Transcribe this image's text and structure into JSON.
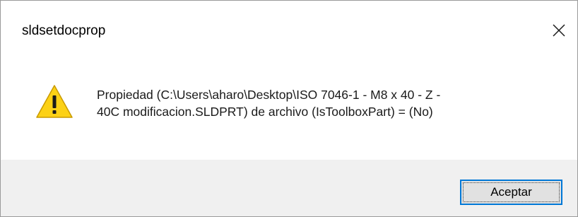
{
  "dialog": {
    "title": "sldsetdocprop",
    "close_icon": "close-icon",
    "warning_icon": "warning-icon",
    "message": "Propiedad (C:\\Users\\aharo\\Desktop\\ISO 7046-1 - M8 x 40 - Z -\n40C modificacion.SLDPRT) de archivo (IsToolboxPart) = (No)",
    "ok_label": "Aceptar"
  },
  "colors": {
    "accent": "#0078d7",
    "warning_fill": "#fcd116",
    "footer_bg": "#f0f0f0",
    "button_bg": "#e1e1e1"
  }
}
